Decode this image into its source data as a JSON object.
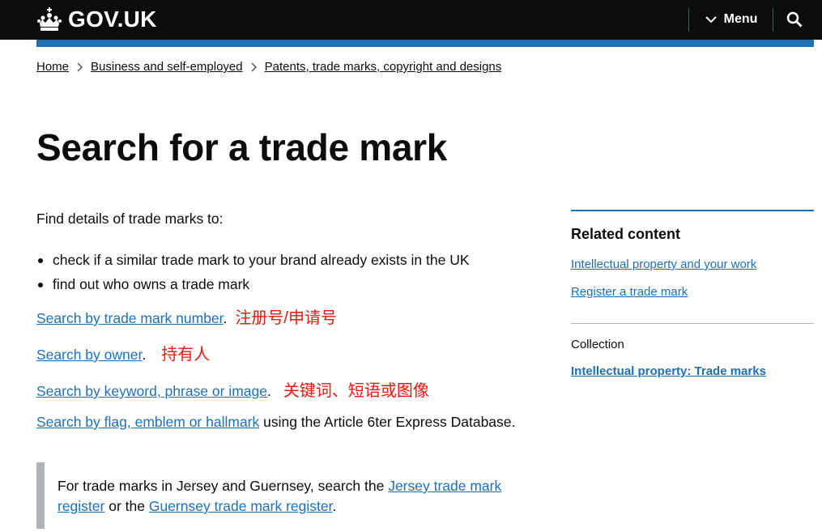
{
  "header": {
    "logo_text": "GOV.UK",
    "menu_label": "Menu",
    "search_label": "Search GOV.UK",
    "background": "#0b0c0c",
    "accent": "#1d70b8"
  },
  "breadcrumb": [
    {
      "label": "Home"
    },
    {
      "label": "Business and self-employed"
    },
    {
      "label": "Patents, trade marks, copyright and designs"
    }
  ],
  "page_title": "Search for a trade mark",
  "content": {
    "intro": "Find details of trade marks to:",
    "bullets": [
      "check if a similar trade mark to your brand already exists in the UK",
      "find out who owns a trade mark"
    ],
    "links": [
      {
        "link_text": "Search by trade mark number",
        "suffix": ".",
        "annotation": "注册号/申请号"
      },
      {
        "link_text": "Search by owner",
        "suffix": ".",
        "annotation": "持有人"
      },
      {
        "link_text": "Search by keyword, phrase or image",
        "suffix": ".",
        "annotation": "关键词、短语或图像"
      },
      {
        "link_text": "Search by flag, emblem or hallmark",
        "suffix": " using the Article 6ter Express Database.",
        "annotation": ""
      }
    ],
    "inset": {
      "text_before": "For trade marks in Jersey and Guernsey, search the ",
      "link1": "Jersey trade mark register",
      "text_middle": " or the ",
      "link2": "Guernsey trade mark register",
      "text_after": "."
    }
  },
  "sidebar": {
    "related_title": "Related content",
    "related_links": [
      "Intellectual property and your work",
      "Register a trade mark"
    ],
    "collection_label": "Collection",
    "collection_link": "Intellectual property: Trade marks"
  },
  "colors": {
    "link": "#1d70b8",
    "text": "#0b0c0c",
    "annotation": "#e8190e",
    "inset_border": "#b1b4b6"
  }
}
